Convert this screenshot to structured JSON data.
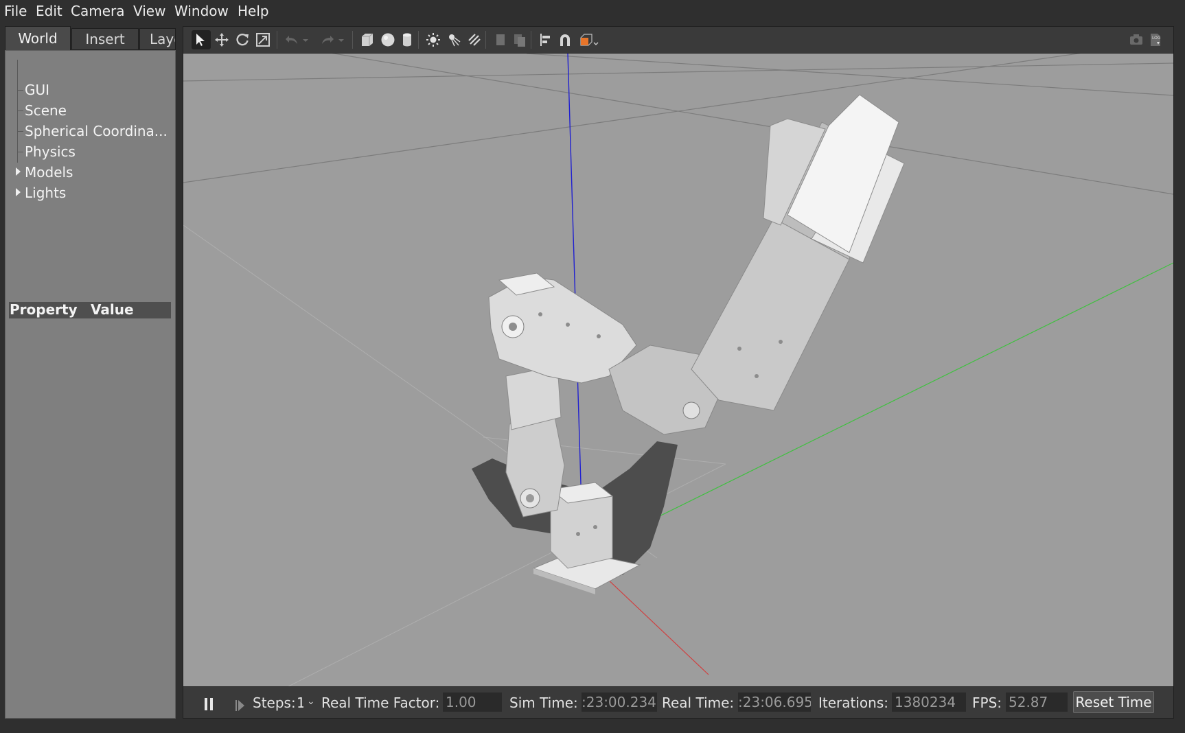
{
  "menu": [
    "File",
    "Edit",
    "Camera",
    "View",
    "Window",
    "Help"
  ],
  "left_panel": {
    "tabs": [
      "World",
      "Insert",
      "Layers"
    ],
    "tree": [
      "GUI",
      "Scene",
      "Spherical Coordina...",
      "Physics",
      "Models",
      "Lights"
    ],
    "property_header": {
      "property": "Property",
      "value": "Value"
    }
  },
  "toolbar": {
    "left_icons": [
      "select-arrow-icon",
      "translate-icon",
      "rotate-icon",
      "scale-icon",
      "undo-icon",
      "undo-dropdown-icon",
      "redo-icon",
      "redo-dropdown-icon",
      "box-shape-icon",
      "sphere-shape-icon",
      "cylinder-shape-icon",
      "point-light-icon",
      "spot-light-icon",
      "directional-light-icon",
      "copy-icon",
      "paste-icon",
      "align-icon",
      "snap-magnet-icon",
      "view-angle-icon"
    ],
    "right_icons": [
      "screenshot-camera-icon",
      "log-record-icon"
    ],
    "accent_color": "#e8752a"
  },
  "statusbar": {
    "steps_label": "Steps:",
    "steps_value": "1",
    "rtf_label": "Real Time Factor:",
    "rtf_value": "1.00",
    "sim_time_label": "Sim Time:",
    "sim_time_value": ":23:00.234",
    "real_time_label": "Real Time:",
    "real_time_value": ":23:06.695",
    "iterations_label": "Iterations:",
    "iterations_value": "1380234",
    "fps_label": "FPS:",
    "fps_value": "52.87",
    "reset_label": "Reset Time"
  },
  "scene": {
    "background_color": "#9d9d9d",
    "axis_colors": {
      "x": "#d04040",
      "y": "#40c040",
      "z": "#2020d0"
    }
  }
}
